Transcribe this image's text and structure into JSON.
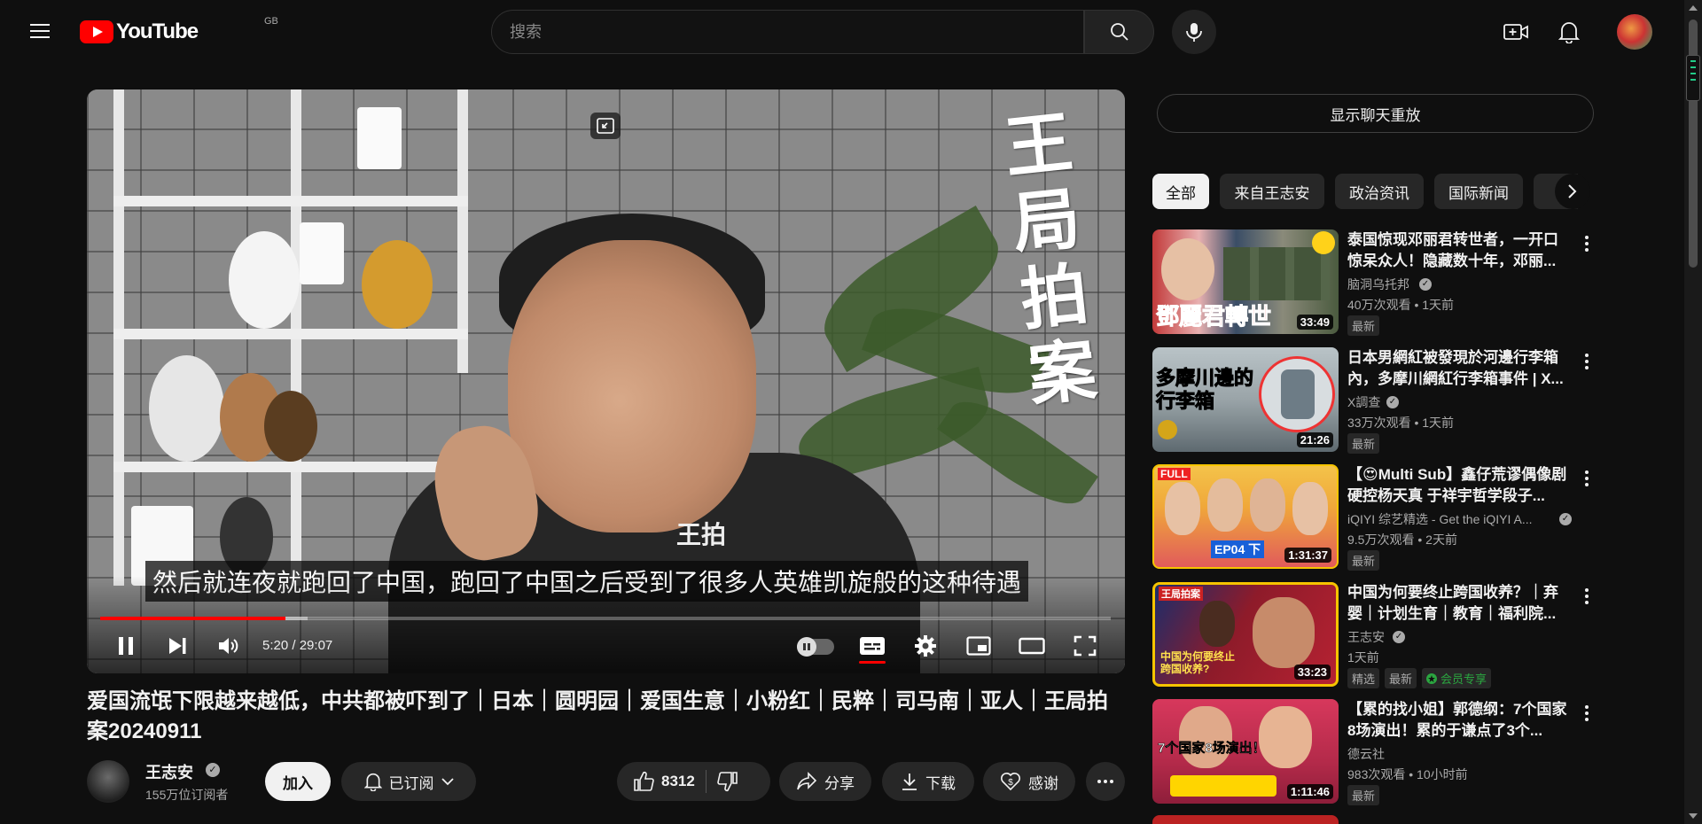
{
  "header": {
    "logo_text": "YouTube",
    "country_code": "GB",
    "search_placeholder": "搜索"
  },
  "player": {
    "watermark": "王局拍案",
    "shirt_logo": "王拍",
    "subtitle": "然后就连夜就跑回了中国，跑回了中国之后受到了很多人英雄凯旋般的这种待遇",
    "time_current": "5:20",
    "time_separator": " / ",
    "time_total": "29:07",
    "progress_played_fraction": 0.1832,
    "progress_buffered_fraction": 0.205
  },
  "video": {
    "title": "爱国流氓下限越来越低，中共都被吓到了｜日本｜圆明园｜爱国生意｜小粉红｜民粹｜司马南｜亚人｜王局拍案20240911",
    "channel_name": "王志安",
    "subscribers": "155万位订阅者",
    "join_label": "加入",
    "subscribed_label": "已订阅",
    "like_count": "8312",
    "share_label": "分享",
    "download_label": "下载",
    "thanks_label": "感谢"
  },
  "sidebar": {
    "chat_replay_label": "显示聊天重放",
    "chips": [
      "全部",
      "来自王志安",
      "政治资讯",
      "国际新闻"
    ],
    "recommendations": [
      {
        "title": "泰国惊现邓丽君转世者，一开口惊呆众人！隐藏数十年，邓丽...",
        "channel": "脑洞乌托邦",
        "verified": true,
        "views": "40万次观看",
        "age": "1天前",
        "duration": "33:49",
        "thumb_text": "鄧麗君轉世",
        "badges": [
          "最新"
        ]
      },
      {
        "title": "日本男網紅被發現於河邊行李箱內，多摩川網紅行李箱事件 | X...",
        "channel": "X調查",
        "verified": true,
        "views": "33万次观看",
        "age": "1天前",
        "duration": "21:26",
        "thumb_text": "多摩川邊的行李箱",
        "badges": [
          "最新"
        ]
      },
      {
        "title": "【😍Multi Sub】鑫仔荒谬偶像剧硬控杨天真 于祥宇哲学段子...",
        "channel": "iQIYI 综艺精选 - Get the iQIYI A...",
        "verified": true,
        "views": "9.5万次观看",
        "age": "2天前",
        "duration": "1:31:37",
        "thumb_text": "EP04 下",
        "badges": [
          "最新"
        ]
      },
      {
        "title": "中国为何要终止跨国收养？｜弃婴｜计划生育｜教育｜福利院...",
        "channel": "王志安",
        "verified": true,
        "views": "",
        "age": "1天前",
        "duration": "33:23",
        "thumb_text": "中国为何要终止跨国收养?",
        "badges": [
          "精选",
          "最新"
        ],
        "member_badge": "会员专享"
      },
      {
        "title": "【累的找小姐】郭德纲：7个国家8场演出！累的于谦点了3个...",
        "channel": "德云社",
        "verified": false,
        "views": "983次观看",
        "age": "10小时前",
        "duration": "1:11:46",
        "thumb_text": "7个国家8场演出！",
        "badges": [
          "最新"
        ]
      }
    ]
  },
  "colors": {
    "background": "#0f0f0f",
    "accent_red": "#ff0000",
    "text_primary": "#f1f1f1",
    "text_secondary": "#aaaaaa",
    "member_green": "#2ba640"
  }
}
